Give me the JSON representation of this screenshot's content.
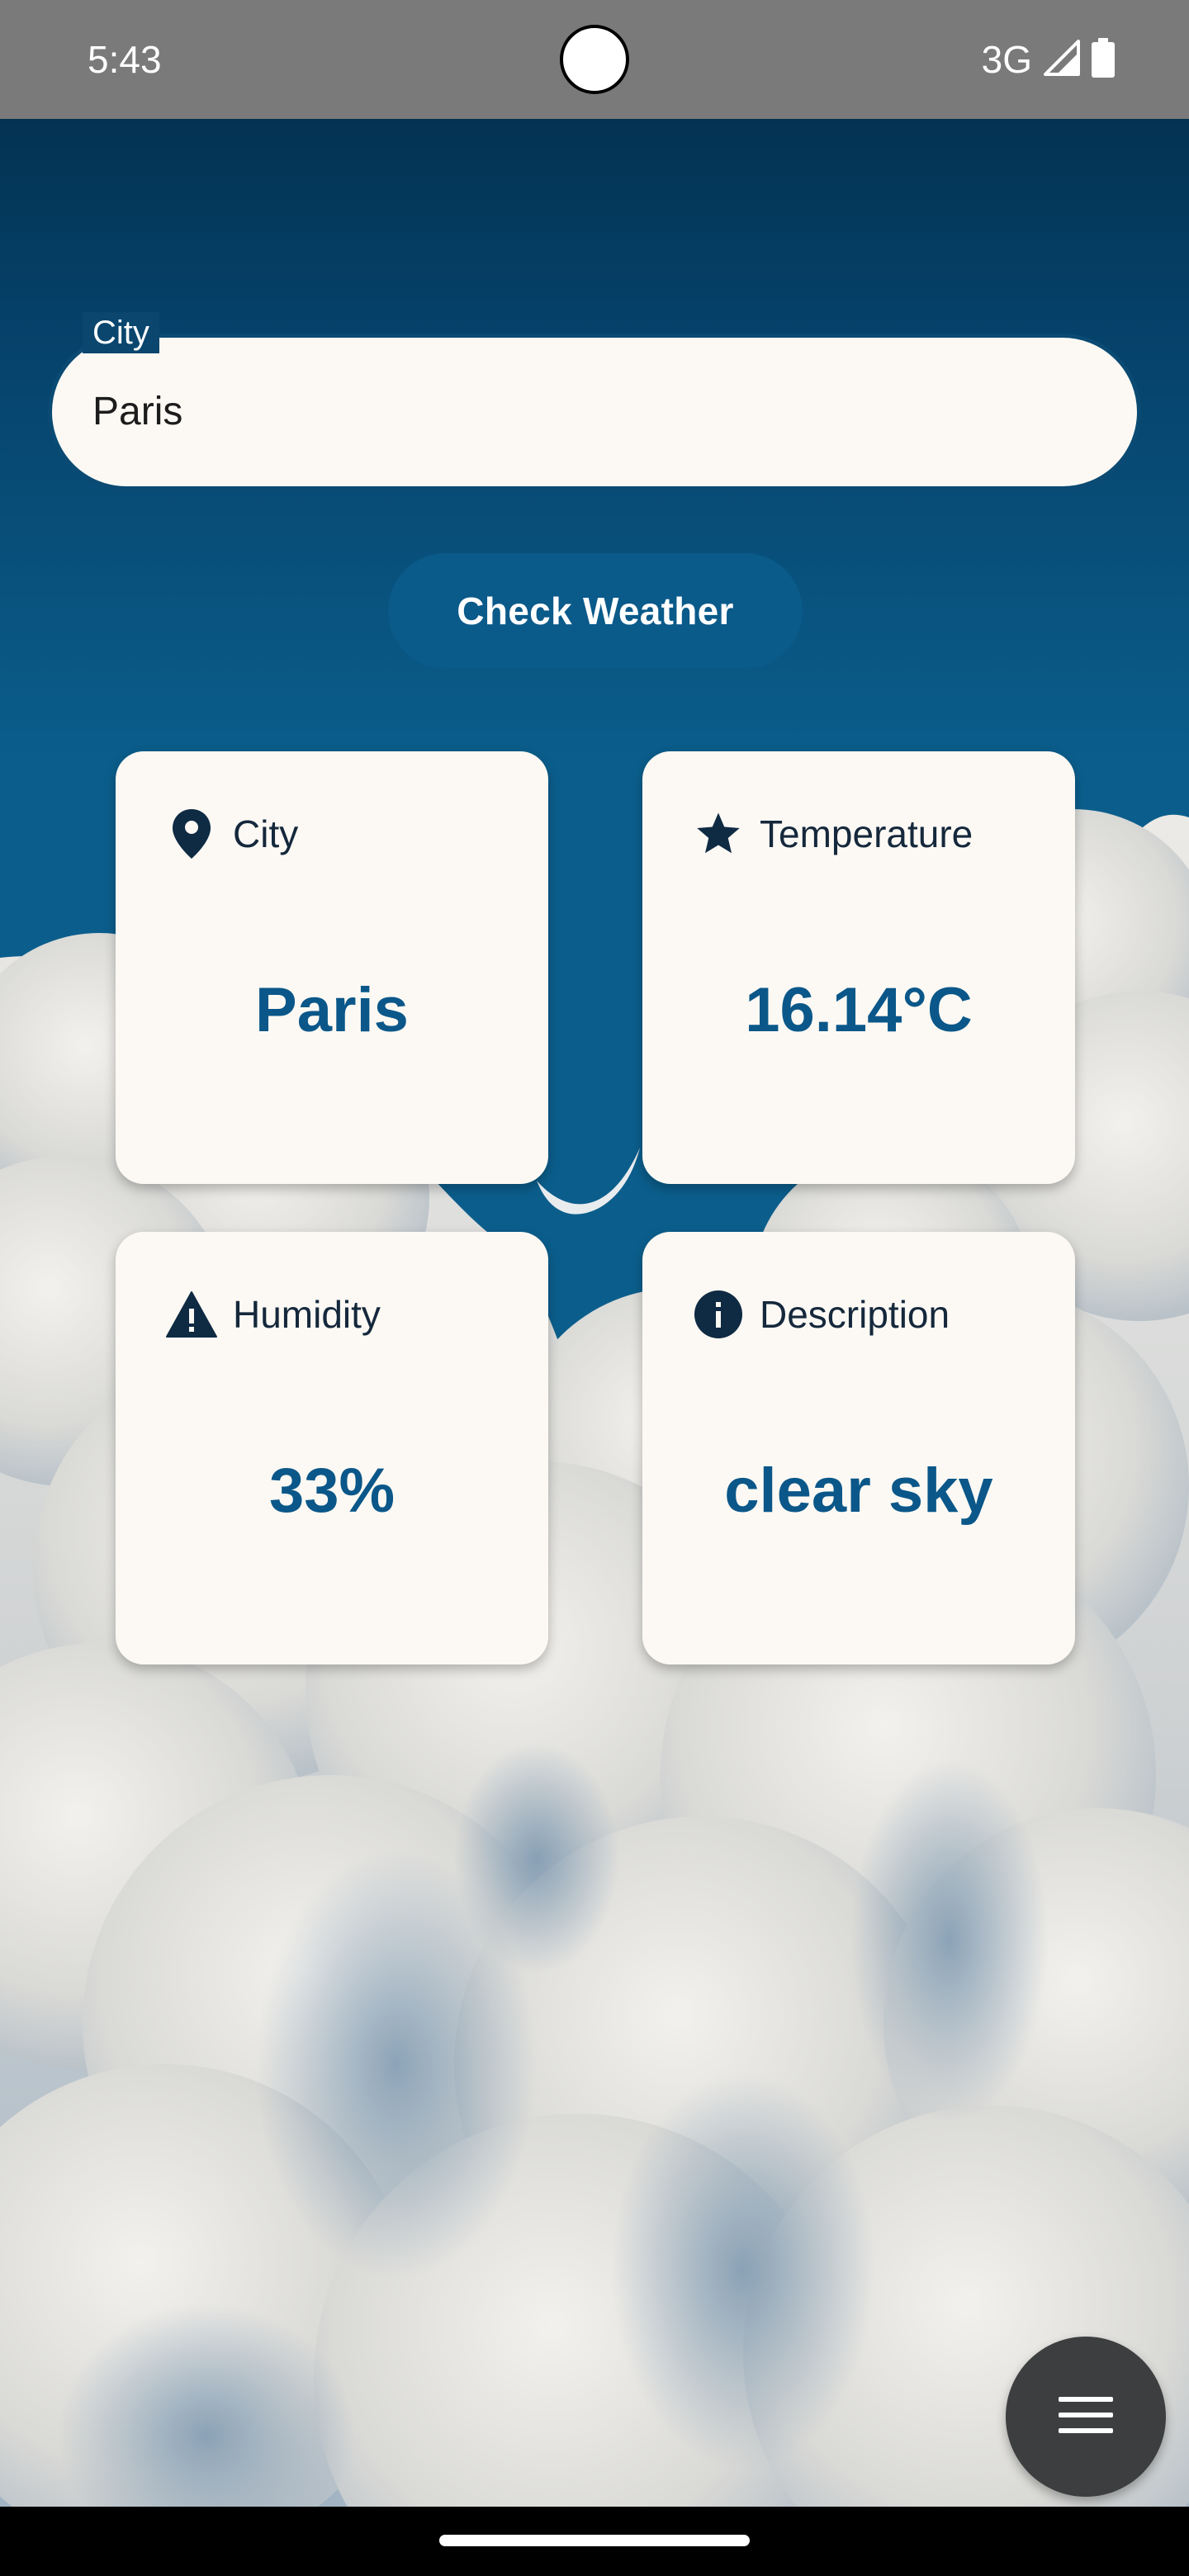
{
  "status_bar": {
    "time": "5:43",
    "network_type": "3G",
    "icons": [
      "signal-icon",
      "battery-icon"
    ]
  },
  "city_input": {
    "label": "City",
    "value": "Paris"
  },
  "check_button": {
    "label": "Check Weather"
  },
  "cards": {
    "city": {
      "title": "City",
      "value": "Paris",
      "icon": "location-pin-icon"
    },
    "temperature": {
      "title": "Temperature",
      "value": "16.14°C",
      "icon": "star-icon"
    },
    "humidity": {
      "title": "Humidity",
      "value": "33%",
      "icon": "warning-icon"
    },
    "description": {
      "title": "Description",
      "value": "clear sky",
      "icon": "info-icon"
    }
  },
  "fab": {
    "icon": "menu-icon"
  },
  "colors": {
    "accent": "#0b5789",
    "card_background": "#fcf9f4",
    "button_background": "#0a5a8a",
    "status_bar": "#7a7a7a",
    "fab_background": "#3d3e40",
    "sky_top": "#032a44",
    "sky_bottom": "#0b5e8c"
  }
}
